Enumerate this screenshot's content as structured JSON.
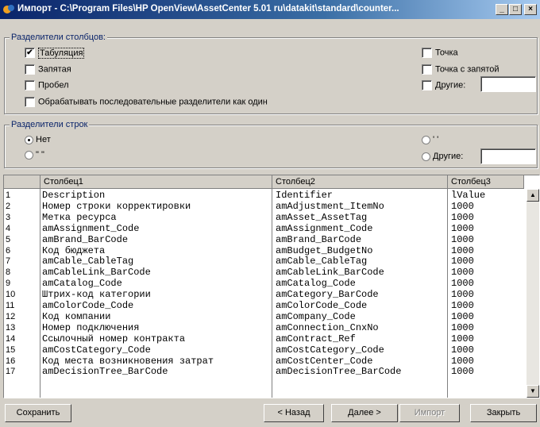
{
  "window": {
    "title": "Импорт - C:\\Program Files\\HP OpenView\\AssetCenter 5.01 ru\\datakit\\standard\\counter...",
    "controls": [
      "_",
      "□",
      "×"
    ]
  },
  "column_separators": {
    "legend": "Разделители столбцов:",
    "tab": {
      "label": "Табуляция",
      "checked": true
    },
    "comma": {
      "label": "Запятая",
      "checked": false
    },
    "space": {
      "label": "Пробел",
      "checked": false
    },
    "consecutive": {
      "label": "Обрабатывать последовательные разделители как один",
      "checked": false
    },
    "dot": {
      "label": "Точка",
      "checked": false
    },
    "semicolon": {
      "label": "Точка с запятой",
      "checked": false
    },
    "other": {
      "label": "Другие:",
      "checked": false,
      "value": ""
    }
  },
  "row_separators": {
    "legend": "Разделители строк",
    "none": {
      "label": "Нет",
      "selected": true
    },
    "double_quote": {
      "label": "\" \"",
      "selected": false
    },
    "single_quote": {
      "label": "' '",
      "selected": false
    },
    "other": {
      "label": "Другие:",
      "selected": false,
      "value": ""
    }
  },
  "grid": {
    "headers": [
      "Столбец1",
      "Столбец2",
      "Столбец3"
    ],
    "rows": [
      {
        "n": "1",
        "c1": "Description",
        "c2": "Identifier",
        "c3": "lValue"
      },
      {
        "n": "2",
        "c1": "Номер строки корректировки",
        "c2": "amAdjustment_ItemNo",
        "c3": "1000"
      },
      {
        "n": "3",
        "c1": "Метка ресурса",
        "c2": "amAsset_AssetTag",
        "c3": "1000"
      },
      {
        "n": "4",
        "c1": "amAssignment_Code",
        "c2": "amAssignment_Code",
        "c3": "1000"
      },
      {
        "n": "5",
        "c1": "amBrand_BarCode",
        "c2": "amBrand_BarCode",
        "c3": "1000"
      },
      {
        "n": "6",
        "c1": "Код бюджета",
        "c2": "amBudget_BudgetNo",
        "c3": "1000"
      },
      {
        "n": "7",
        "c1": "amCable_CableTag",
        "c2": "amCable_CableTag",
        "c3": "1000"
      },
      {
        "n": "8",
        "c1": "amCableLink_BarCode",
        "c2": "amCableLink_BarCode",
        "c3": "1000"
      },
      {
        "n": "9",
        "c1": "amCatalog_Code",
        "c2": "amCatalog_Code",
        "c3": "1000"
      },
      {
        "n": "10",
        "c1": "Штрих-код категории",
        "c2": "amCategory_BarCode",
        "c3": "1000"
      },
      {
        "n": "11",
        "c1": "amColorCode_Code",
        "c2": "amColorCode_Code",
        "c3": "1000"
      },
      {
        "n": "12",
        "c1": "Код компании",
        "c2": "amCompany_Code",
        "c3": "1000"
      },
      {
        "n": "13",
        "c1": "Номер подключения",
        "c2": "amConnection_CnxNo",
        "c3": "1000"
      },
      {
        "n": "14",
        "c1": "Ссылочный номер контракта",
        "c2": "amContract_Ref",
        "c3": "1000"
      },
      {
        "n": "15",
        "c1": "amCostCategory_Code",
        "c2": "amCostCategory_Code",
        "c3": "1000"
      },
      {
        "n": "16",
        "c1": "Код места возникновения затрат",
        "c2": "amCostCenter_Code",
        "c3": "1000"
      },
      {
        "n": "17",
        "c1": "amDecisionTree_BarCode",
        "c2": "amDecisionTree_BarCode",
        "c3": "1000"
      }
    ],
    "scroll_up": "▲",
    "scroll_down": "▼"
  },
  "buttons": {
    "save": "Сохранить",
    "back": "< Назад",
    "next": "Далее >",
    "import": "Импорт",
    "close": "Закрыть"
  }
}
